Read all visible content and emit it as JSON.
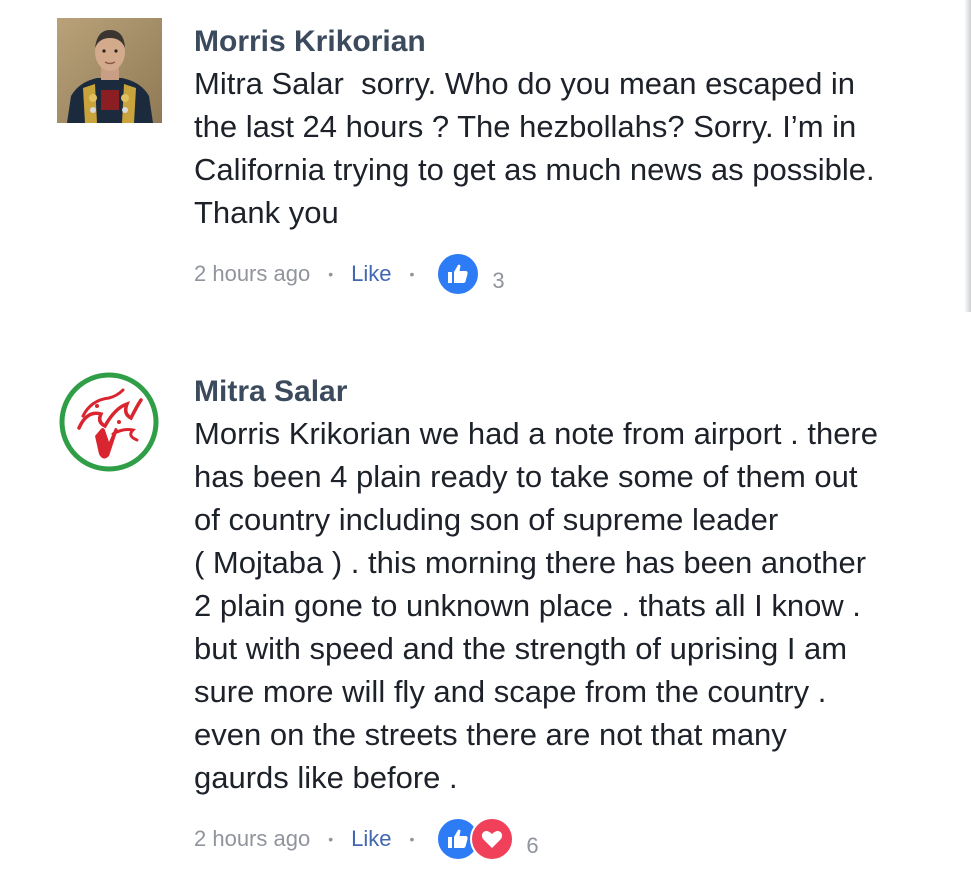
{
  "comments": [
    {
      "author": "Morris Krikorian",
      "text": "Mitra Salar  sorry. Who do you mean escaped in\nthe last 24 hours ? The hezbollahs? Sorry. I’m in\nCalifornia trying to get as much news as possible.\nThank you",
      "timestamp": "2 hours ago",
      "like_label": "Like",
      "reaction_count": "3",
      "reactions": [
        "like-icon"
      ]
    },
    {
      "author": "Mitra Salar",
      "text": "Morris Krikorian we had a note from airport . there\nhas been 4 plain ready to take some of them out\nof country including son of supreme leader\n( Mojtaba ) . this morning there has been another\n2 plain gone to unknown place . thats all I know .\nbut with speed and the strength of uprising I am\nsure more will fly and scape from the country .\neven on the streets there are not that many\ngaurds like before .",
      "timestamp": "2 hours ago",
      "like_label": "Like",
      "reaction_count": "6",
      "reactions": [
        "like-icon",
        "love-icon"
      ]
    }
  ],
  "separator": "•",
  "colors": {
    "author": "#3b4a5c",
    "body": "#1d2129",
    "meta": "#90949c",
    "link": "#4267b2",
    "like_reaction": "#2d7cf6",
    "love_reaction": "#f0405a"
  }
}
